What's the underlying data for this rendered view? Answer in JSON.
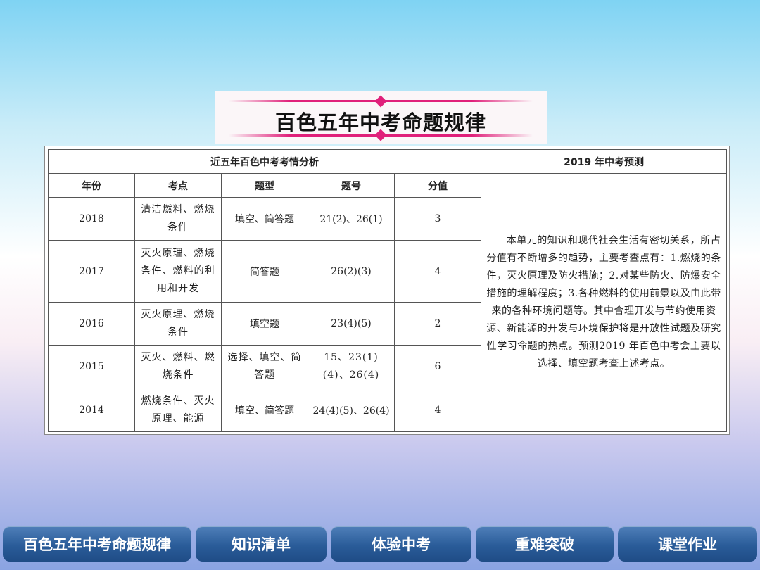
{
  "banner": {
    "title": "百色五年中考命题规律"
  },
  "table": {
    "analysis_header": "近五年百色中考考情分析",
    "prediction_header": "2019 年中考预测",
    "columns": [
      "年份",
      "考点",
      "题型",
      "题号",
      "分值"
    ],
    "rows": [
      {
        "year": "2018",
        "topic": "清洁燃料、燃烧条件",
        "type": "填空、简答题",
        "number": "21(2)、26(1)",
        "score": "3"
      },
      {
        "year": "2017",
        "topic": "灭火原理、燃烧条件、燃料的利用和开发",
        "type": "简答题",
        "number": "26(2)(3)",
        "score": "4"
      },
      {
        "year": "2016",
        "topic": "灭火原理、燃烧条件",
        "type": "填空题",
        "number": "23(4)(5)",
        "score": "2"
      },
      {
        "year": "2015",
        "topic": "灭火、燃料、燃烧条件",
        "type": "选择、填空、简答题",
        "number": "15、23(1)(4)、26(4)",
        "score": "6"
      },
      {
        "year": "2014",
        "topic": "燃烧条件、灭火原理、能源",
        "type": "填空、简答题",
        "number": "24(4)(5)、26(4)",
        "score": "4"
      }
    ],
    "prediction_text": "本单元的知识和现代社会生活有密切关系，所占分值有不断增多的趋势，主要考查点有：1.燃烧的条件，灭火原理及防火措施；2.对某些防火、防爆安全措施的理解程度；3.各种燃料的使用前景以及由此带来的各种环境问题等。其中合理开发与节约使用资源、新能源的开发与环境保护将是开放性试题及研究性学习命题的热点。预测2019 年百色中考会主要以选择、填空题考查上述考点。"
  },
  "nav": {
    "items": [
      "百色五年中考命题规律",
      "知识清单",
      "体验中考",
      "重难突破",
      "课堂作业"
    ]
  },
  "colors": {
    "accent": "#e0207a",
    "nav_bg": "#2a5c99"
  }
}
